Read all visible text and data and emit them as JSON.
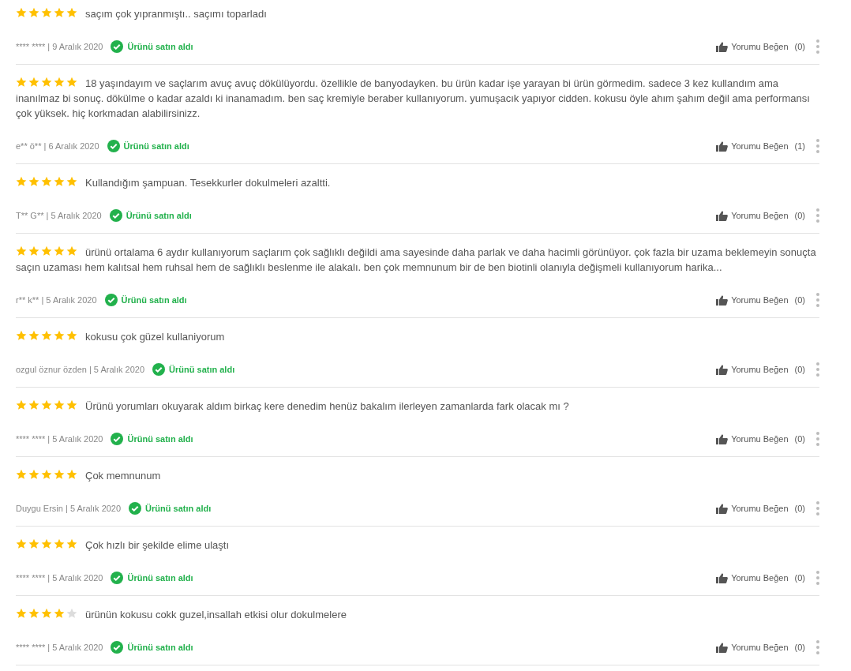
{
  "reviews": [
    {
      "stars": 5,
      "text": "saçım çok yıpranmıştı.. saçımı toparladı",
      "byline": "**** **** | 9 Aralık 2020",
      "verified": "Ürünü satın aldı",
      "like_label": "Yorumu Beğen",
      "like_count": "(0)"
    },
    {
      "stars": 5,
      "text": "18 yaşındayım ve saçlarım avuç avuç dökülüyordu. özellikle de banyodayken. bu ürün kadar işe yarayan bi ürün görmedim. sadece 3 kez kullandım ama inanılmaz bi sonuç. dökülme o kadar azaldı ki inanamadım. ben saç kremiyle beraber kullanıyorum. yumuşacık yapıyor cidden. kokusu öyle ahım şahım değil ama performansı çok yüksek. hiç korkmadan alabilirsinizz.",
      "byline": "e** ö** | 6 Aralık 2020",
      "verified": "Ürünü satın aldı",
      "like_label": "Yorumu Beğen",
      "like_count": "(1)"
    },
    {
      "stars": 5,
      "text": "Kullandığım şampuan. Tesekkurler dokulmeleri azaltti.",
      "byline": "T** G** | 5 Aralık 2020",
      "verified": "Ürünü satın aldı",
      "like_label": "Yorumu Beğen",
      "like_count": "(0)"
    },
    {
      "stars": 5,
      "text": "ürünü ortalama 6 aydır kullanıyorum saçlarım çok sağlıklı değildi ama sayesinde daha parlak ve daha hacimli görünüyor. çok fazla bir uzama beklemeyin sonuçta saçın uzaması hem kalıtsal hem ruhsal hem de sağlıklı beslenme ile alakalı. ben çok memnunum bir de ben biotinli olanıyla değişmeli kullanıyorum harika...",
      "byline": "r** k** | 5 Aralık 2020",
      "verified": "Ürünü satın aldı",
      "like_label": "Yorumu Beğen",
      "like_count": "(0)"
    },
    {
      "stars": 5,
      "text": "kokusu çok güzel kullaniyorum",
      "byline": "ozgul öznur özden | 5 Aralık 2020",
      "verified": "Ürünü satın aldı",
      "like_label": "Yorumu Beğen",
      "like_count": "(0)"
    },
    {
      "stars": 5,
      "text": "Ürünü yorumları okuyarak aldım birkaç kere denedim henüz bakalım ilerleyen zamanlarda fark olacak mı ?",
      "byline": "**** **** | 5 Aralık 2020",
      "verified": "Ürünü satın aldı",
      "like_label": "Yorumu Beğen",
      "like_count": "(0)"
    },
    {
      "stars": 5,
      "text": "Çok memnunum",
      "byline": "Duygu Ersin | 5 Aralık 2020",
      "verified": "Ürünü satın aldı",
      "like_label": "Yorumu Beğen",
      "like_count": "(0)"
    },
    {
      "stars": 5,
      "text": "Çok hızlı bir şekilde elime ulaştı",
      "byline": "**** **** | 5 Aralık 2020",
      "verified": "Ürünü satın aldı",
      "like_label": "Yorumu Beğen",
      "like_count": "(0)"
    },
    {
      "stars": 4,
      "text": "ürünün kokusu cokk guzel,insallah etkisi olur dokulmelere",
      "byline": "**** **** | 5 Aralık 2020",
      "verified": "Ürünü satın aldı",
      "like_label": "Yorumu Beğen",
      "like_count": "(0)"
    }
  ]
}
